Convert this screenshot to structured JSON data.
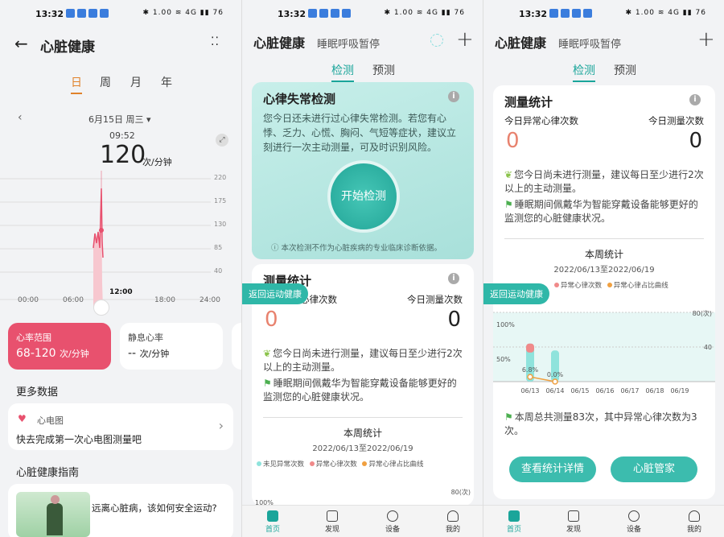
{
  "status": {
    "time": "13:32",
    "right": "✱ 1.00 ≋ 4G ▮▮ 76"
  },
  "p1": {
    "title": "心脏健康",
    "periods": [
      "日",
      "周",
      "月",
      "年"
    ],
    "date": "6月15日 周三",
    "time": "09:52",
    "value": "120",
    "unit": "次/分钟",
    "y_ticks": [
      "220",
      "175",
      "130",
      "85",
      "40"
    ],
    "x_ticks": [
      "00:00",
      "06:00",
      "12:00",
      "18:00",
      "24:00"
    ],
    "range_card": {
      "label": "心率范围",
      "value": "68-120",
      "unit": "次/分钟"
    },
    "rest_card": {
      "label": "静息心率",
      "value": "--",
      "unit": "次/分钟"
    },
    "more_title": "更多数据",
    "ecg": {
      "title": "心电图",
      "desc": "快去完成第一次心电图测量吧"
    },
    "guide_title": "心脏健康指南",
    "guide_item": "远离心脏病，该如何安全运动?"
  },
  "header": {
    "title": "心脏健康",
    "subtitle": "睡眠呼吸暂停"
  },
  "tabs": [
    "检测",
    "预测"
  ],
  "p2": {
    "arr_title": "心律失常检测",
    "arr_desc": "您今日还未进行过心律失常检测。若您有心悸、乏力、心慌、胸闷、气短等症状，建议立刻进行一次主动测量，可及时识别风险。",
    "start_button": "开始检测",
    "disclaimer": "本次检测不作为心脏疾病的专业临床诊断依据。",
    "stats_title": "测量统计",
    "back_pill": "返回运动健康",
    "abn_label": "今日异常心律次数",
    "abn_value": "0",
    "count_label": "今日测量次数",
    "count_value": "0",
    "tip1": "您今日尚未进行测量，建议每日至少进行2次以上的主动测量。",
    "tip2": "睡眠期间佩戴华为智能穿戴设备能够更好的监测您的心脏健康状况。",
    "week_title": "本周统计",
    "week_range": "2022/06/13至2022/06/19",
    "legend": [
      "未见异常次数",
      "异常心律次数",
      "异常心律占比曲线"
    ],
    "axis_right": "80(次)",
    "axis_left": "100%"
  },
  "p3": {
    "stats_title": "测量统计",
    "abn_label": "今日异常心律次数",
    "abn_value": "0",
    "count_label": "今日测量次数",
    "count_value": "0",
    "tip1": "您今日尚未进行测量，建议每日至少进行2次以上的主动测量。",
    "tip2": "睡眠期间佩戴华为智能穿戴设备能够更好的监测您的心脏健康状况。",
    "week_title": "本周统计",
    "week_range": "2022/06/13至2022/06/19",
    "legend": [
      "异常心律次数",
      "异常心律占比曲线"
    ],
    "back_pill": "返回运动健康",
    "chart_y_right": [
      "80(次)",
      "40"
    ],
    "chart_y_left": [
      "100%",
      "50%"
    ],
    "labels_pct": [
      "6.8%",
      "0.0%"
    ],
    "summary": "本周总共测量83次，其中异常心律次数为3次。",
    "btn_detail": "查看统计详情",
    "btn_manager": "心脏管家"
  },
  "chart_data": {
    "type": "bar",
    "categories": [
      "06/13",
      "06/14",
      "06/15",
      "06/16",
      "06/17",
      "06/18",
      "06/19"
    ],
    "series": [
      {
        "name": "未见异常次数",
        "values": [
          44,
          36,
          0,
          0,
          0,
          0,
          0
        ]
      },
      {
        "name": "异常心律次数",
        "values": [
          3,
          0,
          0,
          0,
          0,
          0,
          0
        ]
      },
      {
        "name": "异常心律占比曲线",
        "values": [
          6.8,
          0.0,
          null,
          null,
          null,
          null,
          null
        ]
      }
    ],
    "ylim": [
      0,
      80
    ],
    "colors": {
      "normal": "#8fe3dc",
      "abnormal": "#f08a8a",
      "ratio": "#f0a040"
    }
  },
  "nav": [
    "首页",
    "发现",
    "设备",
    "我的"
  ],
  "accent": "#1aa59a"
}
